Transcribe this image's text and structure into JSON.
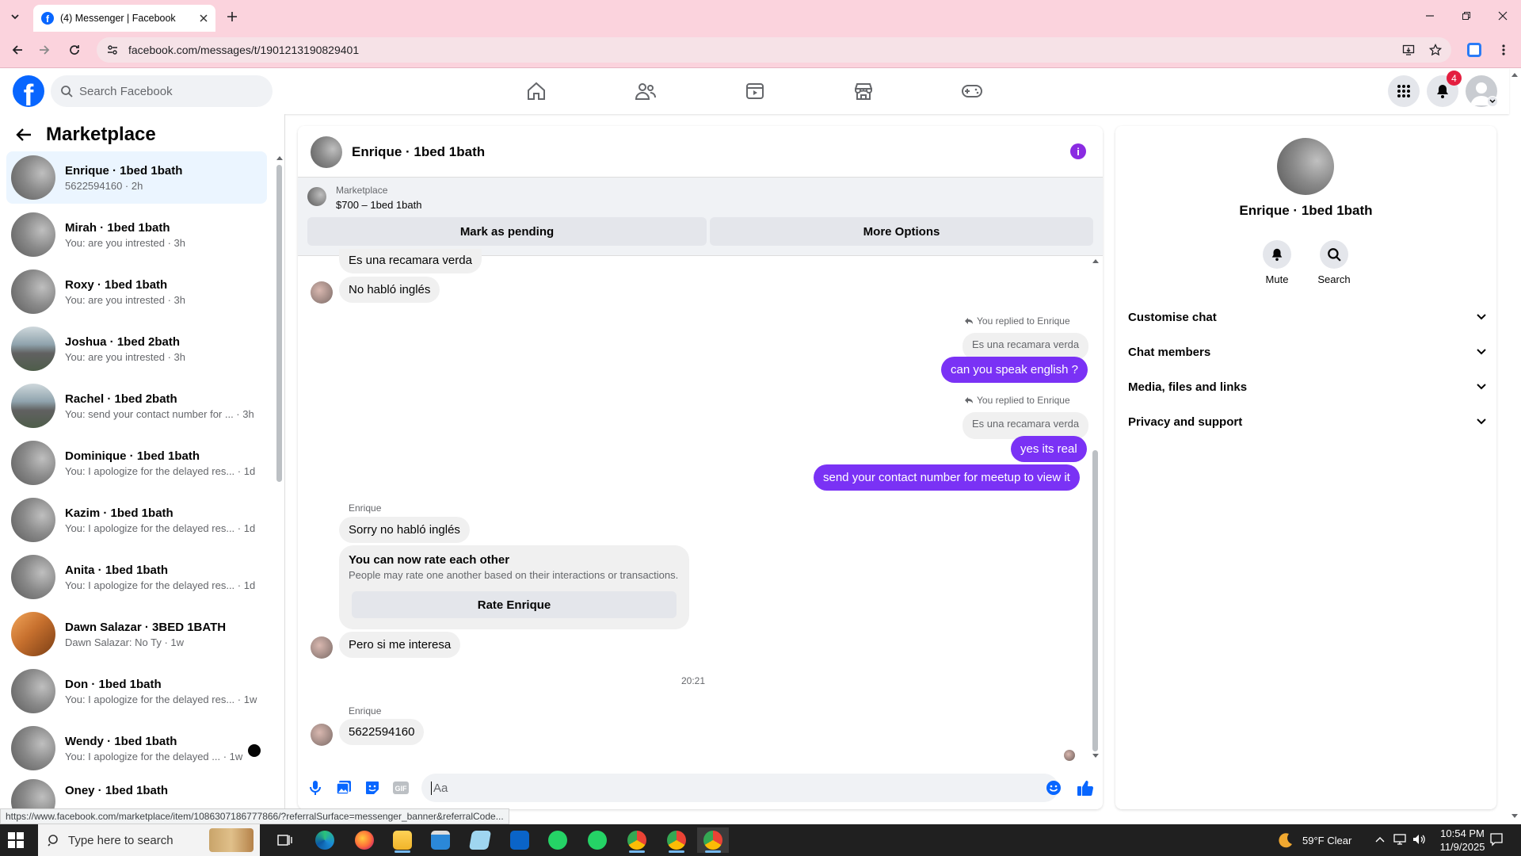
{
  "browser": {
    "tab_title": "(4) Messenger | Facebook",
    "url": "facebook.com/messages/t/1901213190829401",
    "status_link": "https://www.facebook.com/marketplace/item/1086307186777866/?referralSurface=messenger_banner&referralCode..."
  },
  "facebook": {
    "search_placeholder": "Search Facebook",
    "notification_count": "4"
  },
  "sidebar": {
    "title": "Marketplace",
    "conversations": [
      {
        "name": "Enrique · 1bed 1bath",
        "preview": "5622594160 · 2h"
      },
      {
        "name": "Mirah · 1bed 1bath",
        "preview": "You: are you intrested · 3h"
      },
      {
        "name": "Roxy · 1bed 1bath",
        "preview": "You: are you intrested · 3h"
      },
      {
        "name": "Joshua · 1bed 2bath",
        "preview": "You: are you intrested · 3h"
      },
      {
        "name": "Rachel · 1bed 2bath",
        "preview": "You: send your contact number for ... · 3h"
      },
      {
        "name": "Dominique · 1bed 1bath",
        "preview": "You: I apologize for the delayed res... · 1d"
      },
      {
        "name": "Kazim · 1bed 1bath",
        "preview": "You: I apologize for the delayed res... · 1d"
      },
      {
        "name": "Anita · 1bed 1bath",
        "preview": "You: I apologize for the delayed res... · 1d"
      },
      {
        "name": "Dawn Salazar · 3BED 1BATH",
        "preview": "Dawn Salazar: No Ty · 1w"
      },
      {
        "name": "Don · 1bed 1bath",
        "preview": "You: I apologize for the delayed res... · 1w"
      },
      {
        "name": "Wendy · 1bed 1bath",
        "preview": "You: I apologize for the delayed ... · 1w"
      },
      {
        "name": "Oney · 1bed 1bath",
        "preview": ""
      }
    ]
  },
  "chat": {
    "title": "Enrique · 1bed 1bath",
    "marketplace_label": "Marketplace",
    "listing": "$700 – 1bed 1bath",
    "mark_pending": "Mark as pending",
    "more_options": "More Options",
    "messages": {
      "m1": "Es una recamara verda",
      "m2": "No habló inglés",
      "reply_note_1": "You replied to Enrique",
      "quote_1": "Es una recamara verda",
      "out_1": "can you speak english ?",
      "reply_note_2": "You replied to Enrique",
      "quote_2": "Es una recamara verda",
      "out_2": "yes its real",
      "out_3": "send your contact number for meetup to view it",
      "sender_1": "Enrique",
      "in_3": "Sorry no habló inglés",
      "rate_title": "You can now rate each other",
      "rate_desc": "People may rate one another based on their interactions or transactions.",
      "rate_button": "Rate Enrique",
      "in_4": "Pero si me interesa",
      "time": "20:21",
      "sender_2": "Enrique",
      "in_5": "5622594160"
    },
    "input_placeholder": "Aa"
  },
  "info": {
    "name": "Enrique · 1bed 1bath",
    "mute": "Mute",
    "search": "Search",
    "sections": [
      "Customise chat",
      "Chat members",
      "Media, files and links",
      "Privacy and support"
    ]
  },
  "taskbar": {
    "search_placeholder": "Type here to search",
    "weather": "59°F  Clear",
    "time": "10:54 PM",
    "date": "11/9/2025"
  },
  "colors": {
    "brand": "#0866ff",
    "outgoing_bubble": "#7a32f5",
    "browser_frame": "#fbd3dd",
    "notification": "#e41e3f"
  }
}
